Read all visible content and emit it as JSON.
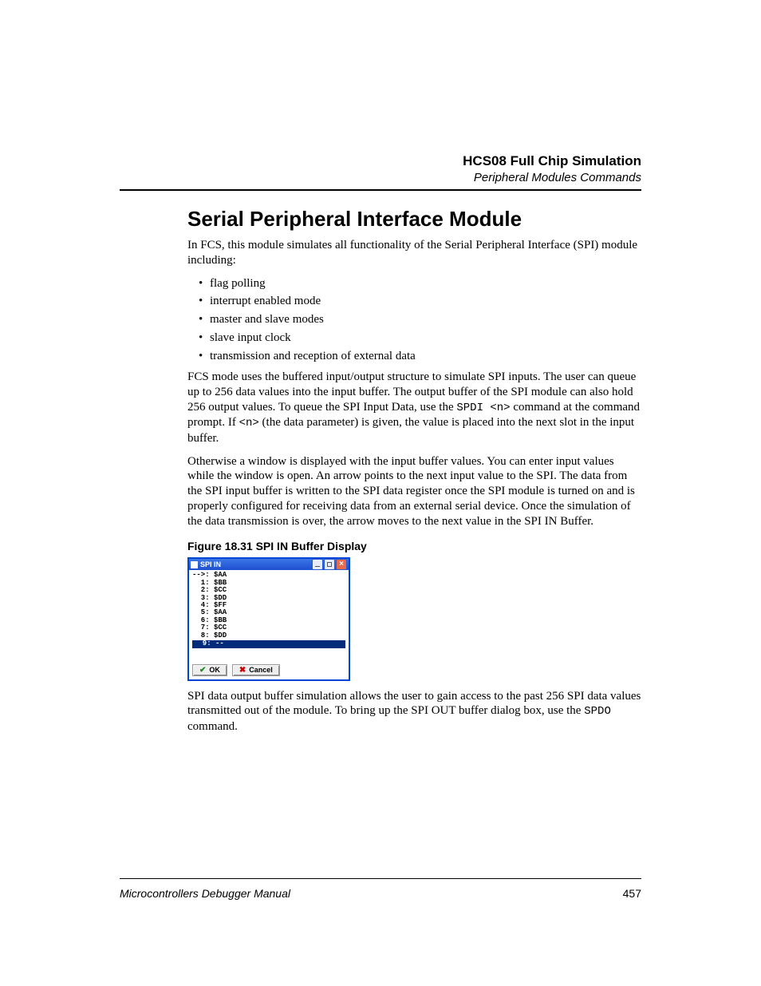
{
  "header": {
    "title": "HCS08 Full Chip Simulation",
    "subtitle": "Peripheral Modules Commands"
  },
  "heading": "Serial Peripheral Interface Module",
  "intro": "In FCS, this module simulates all functionality of the Serial Peripheral Interface (SPI) module including:",
  "bullets": [
    "flag polling",
    "interrupt enabled mode",
    "master and slave modes",
    "slave input clock",
    "transmission and reception of external data"
  ],
  "para2_a": "FCS mode uses the buffered input/output structure to simulate SPI inputs. The user can queue up to 256 data values into the input buffer. The output buffer of the SPI module can also hold 256 output values. To queue the SPI Input Data, use the ",
  "para2_code1": "SPDI <n>",
  "para2_b": " command at the command prompt. If ",
  "para2_code2": "<n>",
  "para2_c": " (the data parameter) is given, the value is placed into the next slot in the input buffer.",
  "para3": "Otherwise a window is displayed with the input buffer values. You can enter input values while the window is open. An arrow points to the next input value to the SPI. The data from the SPI input buffer is written to the SPI data register once the SPI module is turned on and is properly configured for receiving data from an external serial device. Once the simulation of the data transmission is over, the arrow moves to the next value in the SPI IN Buffer.",
  "figure_caption": "Figure 18.31  SPI IN Buffer Display",
  "dialog": {
    "title": "SPI IN",
    "rows": [
      "-->: $AA",
      "  1: $BB",
      "  2: $CC",
      "  3: $DD",
      "  4: $FF",
      "  5: $AA",
      "  6: $BB",
      "  7: $CC",
      "  8: $DD"
    ],
    "selected": "  9: --",
    "ok": "OK",
    "cancel": "Cancel"
  },
  "para4_a": "SPI data output buffer simulation allows the user to gain access to the past 256 SPI data values transmitted out of the module. To bring up the SPI OUT buffer dialog box, use the ",
  "para4_code": "SPDO",
  "para4_b": " command.",
  "footer": {
    "manual": "Microcontrollers Debugger Manual",
    "page": "457"
  }
}
